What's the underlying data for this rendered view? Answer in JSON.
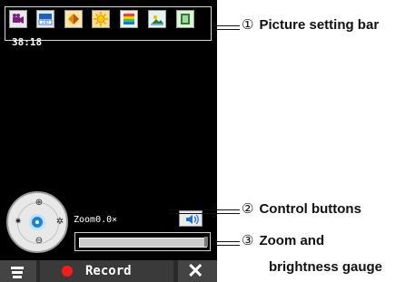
{
  "picture_setting_bar": {
    "icons": [
      {
        "name": "movie-camera-icon",
        "bg": "#e8e8e8"
      },
      {
        "name": "resolution-icon",
        "bg": "#dfe8ff",
        "text": "240"
      },
      {
        "name": "exposure-icon",
        "bg": "#ffe2a8"
      },
      {
        "name": "white-balance-icon",
        "bg": "#ffe08a"
      },
      {
        "name": "color-icon",
        "bg": "#f3f3f3"
      },
      {
        "name": "scene-icon",
        "bg": "#e4f2f2"
      },
      {
        "name": "frame-icon",
        "bg": "#dff3d9"
      }
    ]
  },
  "recording_timer": "38:18",
  "zoom_label": "Zoom0.0×",
  "zoom_gauge": {
    "level": 0.0
  },
  "bottom_bar": {
    "record_label": "Record",
    "accent": "#ff1a1a"
  },
  "annotations": {
    "picture_setting_bar": {
      "number": "①",
      "text": "Picture setting bar"
    },
    "control_buttons": {
      "number": "②",
      "text": "Control buttons"
    },
    "zoom_brightness": {
      "number": "③",
      "line1": "Zoom and",
      "line2": "brightness gauge"
    }
  }
}
